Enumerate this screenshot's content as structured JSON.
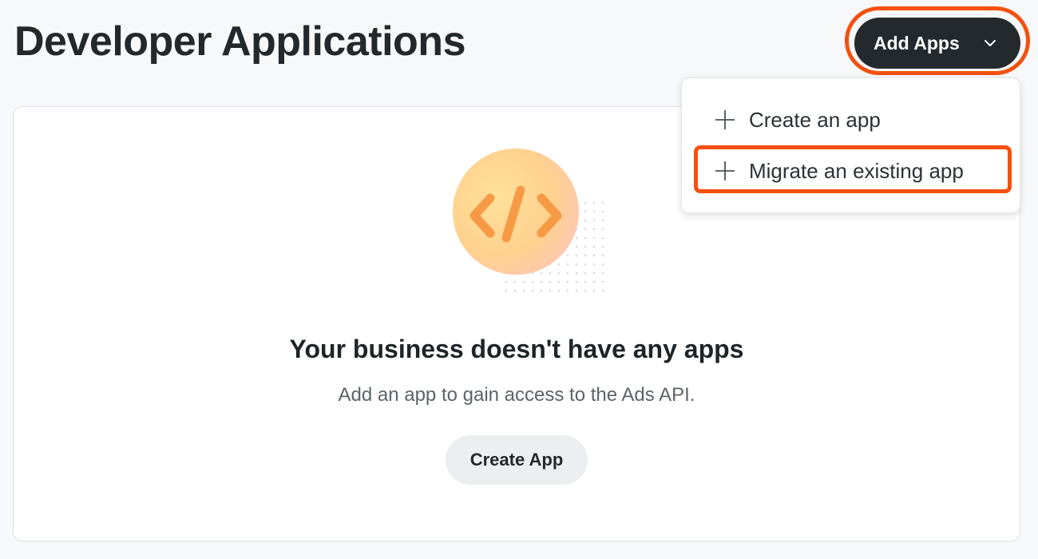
{
  "header": {
    "title": "Developer Applications"
  },
  "add_apps": {
    "label": "Add Apps",
    "icon": "chevron-down-icon",
    "highlight_color": "#f4500f"
  },
  "dropdown": {
    "items": [
      {
        "label": "Create an app",
        "icon": "plus-icon"
      },
      {
        "label": "Migrate an existing app",
        "icon": "plus-icon"
      }
    ]
  },
  "empty_state": {
    "illustration_icon": "code-brackets-icon",
    "title": "Your business doesn't have any apps",
    "subtitle": "Add an app to gain access to the Ads API.",
    "button_label": "Create App"
  },
  "colors": {
    "primary_button": "#24292d",
    "accent": "#f4500f",
    "background": "#f7f8fa"
  }
}
